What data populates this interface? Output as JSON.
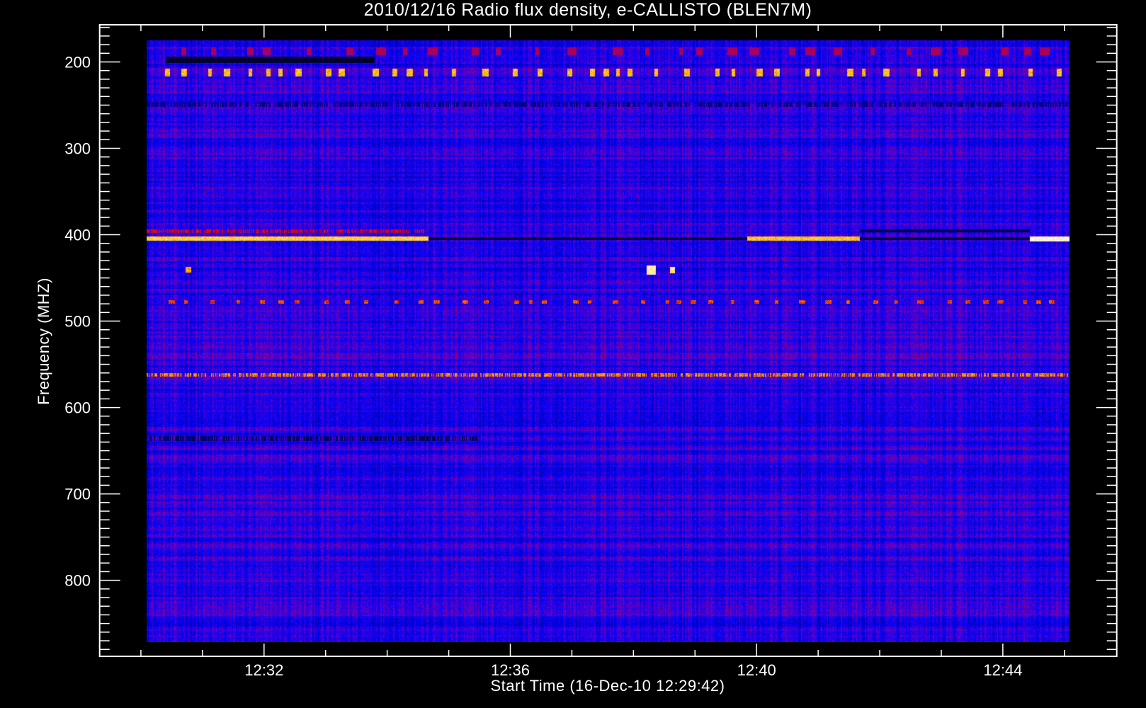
{
  "chart_data": {
    "type": "heatmap",
    "title": "2010/12/16  Radio flux density, e-CALLISTO (BLEN7M)",
    "xlabel": "Start Time (16-Dec-10 12:29:42)",
    "ylabel": "Frequency (MHZ)",
    "x_unit": "minutes after 12:00 UT",
    "xlim": [
      29.33,
      45.85
    ],
    "ylim": [
      888,
      157
    ],
    "data_extent": {
      "time": [
        30.09,
        45.08
      ],
      "frequency": [
        175,
        872
      ]
    },
    "x_major_ticks": [
      {
        "value": 32,
        "label": "12:32"
      },
      {
        "value": 36,
        "label": "12:36"
      },
      {
        "value": 40,
        "label": "12:40"
      },
      {
        "value": 44,
        "label": "12:44"
      }
    ],
    "x_minor_step": 1,
    "y_major_ticks": [
      {
        "value": 200,
        "label": "200"
      },
      {
        "value": 300,
        "label": "300"
      },
      {
        "value": 400,
        "label": "400"
      },
      {
        "value": 500,
        "label": "500"
      },
      {
        "value": 600,
        "label": "600"
      },
      {
        "value": 700,
        "label": "700"
      },
      {
        "value": 800,
        "label": "800"
      }
    ],
    "y_minor_step": 10,
    "colormap": [
      "#000000",
      "#000078",
      "#0000ff",
      "#7800b4",
      "#dc0000",
      "#ffc800",
      "#ffffff"
    ],
    "background_level": 0.42,
    "features": [
      {
        "name": "band-187-bursts",
        "f": [
          183,
          192
        ],
        "t": [
          30.09,
          45.08
        ],
        "level": 0.62,
        "style": "sparse"
      },
      {
        "name": "band-197-dark",
        "f": [
          194,
          201
        ],
        "t": [
          30.4,
          33.8
        ],
        "level": 0.08,
        "style": "solid"
      },
      {
        "name": "band-213-bursts",
        "f": [
          208,
          217
        ],
        "t": [
          30.09,
          45.08
        ],
        "level": 0.85,
        "style": "dotted"
      },
      {
        "name": "band-249-dark",
        "f": [
          246,
          252
        ],
        "t": [
          30.09,
          45.08
        ],
        "level": 0.22,
        "style": "speckled"
      },
      {
        "name": "band-395-red",
        "f": [
          394,
          398
        ],
        "t": [
          30.09,
          34.6
        ],
        "level": 0.68,
        "style": "speckled"
      },
      {
        "name": "band-405-bright",
        "f": [
          402,
          407
        ],
        "t": [
          30.09,
          34.67
        ],
        "level": 0.88,
        "style": "solid"
      },
      {
        "name": "band-405-dark",
        "f": [
          403,
          406
        ],
        "t": [
          34.67,
          39.85
        ],
        "level": 0.1,
        "style": "solid"
      },
      {
        "name": "band-405-bright-2",
        "f": [
          402,
          407
        ],
        "t": [
          39.85,
          41.68
        ],
        "level": 0.86,
        "style": "solid"
      },
      {
        "name": "band-396-dark",
        "f": [
          394,
          397
        ],
        "t": [
          41.68,
          44.44
        ],
        "level": 0.12,
        "style": "solid"
      },
      {
        "name": "band-405-dark-2",
        "f": [
          403,
          406
        ],
        "t": [
          41.68,
          44.44
        ],
        "level": 0.1,
        "style": "solid"
      },
      {
        "name": "band-405-white",
        "f": [
          402,
          408
        ],
        "t": [
          44.44,
          45.08
        ],
        "level": 0.98,
        "style": "solid"
      },
      {
        "name": "spot-440-a",
        "f": [
          437,
          444
        ],
        "t": [
          30.72,
          30.82
        ],
        "level": 0.82,
        "style": "solid"
      },
      {
        "name": "spot-440-b",
        "f": [
          436,
          446
        ],
        "t": [
          38.22,
          38.36
        ],
        "level": 0.95,
        "style": "solid"
      },
      {
        "name": "spot-440-c",
        "f": [
          437,
          445
        ],
        "t": [
          38.6,
          38.68
        ],
        "level": 0.92,
        "style": "solid"
      },
      {
        "name": "band-478-dotted",
        "f": [
          476,
          480
        ],
        "t": [
          30.09,
          45.08
        ],
        "level": 0.75,
        "style": "dotted"
      },
      {
        "name": "band-562-speckled",
        "f": [
          560,
          564
        ],
        "t": [
          30.09,
          45.08
        ],
        "level": 0.8,
        "style": "speckled"
      },
      {
        "name": "band-636-dark",
        "f": [
          633,
          639
        ],
        "t": [
          30.09,
          35.5
        ],
        "level": 0.15,
        "style": "speckled"
      }
    ]
  }
}
